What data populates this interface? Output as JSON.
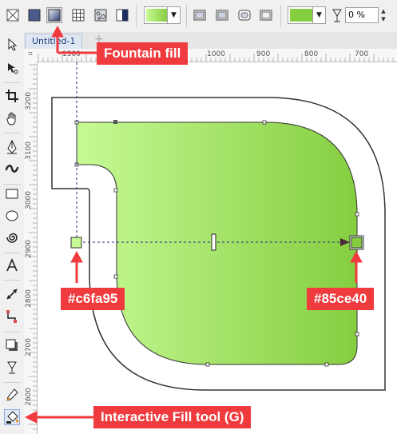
{
  "document": {
    "tab_label": "Untitled-1",
    "add_tab_symbol": "+"
  },
  "propbar": {
    "buttons": [
      {
        "name": "no-fill-icon"
      },
      {
        "name": "uniform-fill-icon"
      },
      {
        "name": "fountain-fill-icon",
        "active": true
      },
      {
        "name": "pattern-fill-icon"
      },
      {
        "name": "texture-fill-icon"
      },
      {
        "name": "postscript-fill-icon"
      }
    ],
    "gradient_preview": {
      "start": "#c6fa95",
      "end": "#85ce40"
    },
    "node_color": "#85ce40",
    "transparency_value": "0 %"
  },
  "rulers": {
    "corner_symbol": "⌗",
    "horizontal": [
      "1300",
      "1000",
      "900",
      "800",
      "700"
    ],
    "vertical": [
      "3200",
      "3100",
      "3000",
      "2900",
      "2800",
      "2700",
      "2600"
    ]
  },
  "fill": {
    "start_color": "#c6fa95",
    "end_color": "#85ce40",
    "midpoint": 0.5
  },
  "callouts": {
    "fountain_fill": "Fountain fill",
    "start_color_label": "#c6fa95",
    "end_color_label": "#85ce40",
    "interactive_tool": "Interactive Fill tool (G)"
  },
  "colors": {
    "accent": "#ef3a3e",
    "guide": "#1f2a8a",
    "outline": "#333333"
  }
}
